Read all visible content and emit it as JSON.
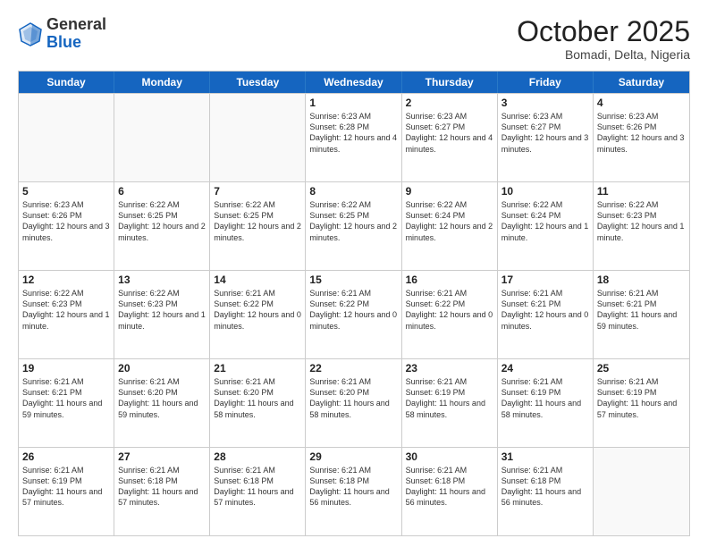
{
  "header": {
    "logo_general": "General",
    "logo_blue": "Blue",
    "month_title": "October 2025",
    "location": "Bomadi, Delta, Nigeria"
  },
  "days_of_week": [
    "Sunday",
    "Monday",
    "Tuesday",
    "Wednesday",
    "Thursday",
    "Friday",
    "Saturday"
  ],
  "weeks": [
    [
      {
        "day": "",
        "empty": true
      },
      {
        "day": "",
        "empty": true
      },
      {
        "day": "",
        "empty": true
      },
      {
        "day": "1",
        "sunrise": "Sunrise: 6:23 AM",
        "sunset": "Sunset: 6:28 PM",
        "daylight": "Daylight: 12 hours and 4 minutes."
      },
      {
        "day": "2",
        "sunrise": "Sunrise: 6:23 AM",
        "sunset": "Sunset: 6:27 PM",
        "daylight": "Daylight: 12 hours and 4 minutes."
      },
      {
        "day": "3",
        "sunrise": "Sunrise: 6:23 AM",
        "sunset": "Sunset: 6:27 PM",
        "daylight": "Daylight: 12 hours and 3 minutes."
      },
      {
        "day": "4",
        "sunrise": "Sunrise: 6:23 AM",
        "sunset": "Sunset: 6:26 PM",
        "daylight": "Daylight: 12 hours and 3 minutes."
      }
    ],
    [
      {
        "day": "5",
        "sunrise": "Sunrise: 6:23 AM",
        "sunset": "Sunset: 6:26 PM",
        "daylight": "Daylight: 12 hours and 3 minutes."
      },
      {
        "day": "6",
        "sunrise": "Sunrise: 6:22 AM",
        "sunset": "Sunset: 6:25 PM",
        "daylight": "Daylight: 12 hours and 2 minutes."
      },
      {
        "day": "7",
        "sunrise": "Sunrise: 6:22 AM",
        "sunset": "Sunset: 6:25 PM",
        "daylight": "Daylight: 12 hours and 2 minutes."
      },
      {
        "day": "8",
        "sunrise": "Sunrise: 6:22 AM",
        "sunset": "Sunset: 6:25 PM",
        "daylight": "Daylight: 12 hours and 2 minutes."
      },
      {
        "day": "9",
        "sunrise": "Sunrise: 6:22 AM",
        "sunset": "Sunset: 6:24 PM",
        "daylight": "Daylight: 12 hours and 2 minutes."
      },
      {
        "day": "10",
        "sunrise": "Sunrise: 6:22 AM",
        "sunset": "Sunset: 6:24 PM",
        "daylight": "Daylight: 12 hours and 1 minute."
      },
      {
        "day": "11",
        "sunrise": "Sunrise: 6:22 AM",
        "sunset": "Sunset: 6:23 PM",
        "daylight": "Daylight: 12 hours and 1 minute."
      }
    ],
    [
      {
        "day": "12",
        "sunrise": "Sunrise: 6:22 AM",
        "sunset": "Sunset: 6:23 PM",
        "daylight": "Daylight: 12 hours and 1 minute."
      },
      {
        "day": "13",
        "sunrise": "Sunrise: 6:22 AM",
        "sunset": "Sunset: 6:23 PM",
        "daylight": "Daylight: 12 hours and 1 minute."
      },
      {
        "day": "14",
        "sunrise": "Sunrise: 6:21 AM",
        "sunset": "Sunset: 6:22 PM",
        "daylight": "Daylight: 12 hours and 0 minutes."
      },
      {
        "day": "15",
        "sunrise": "Sunrise: 6:21 AM",
        "sunset": "Sunset: 6:22 PM",
        "daylight": "Daylight: 12 hours and 0 minutes."
      },
      {
        "day": "16",
        "sunrise": "Sunrise: 6:21 AM",
        "sunset": "Sunset: 6:22 PM",
        "daylight": "Daylight: 12 hours and 0 minutes."
      },
      {
        "day": "17",
        "sunrise": "Sunrise: 6:21 AM",
        "sunset": "Sunset: 6:21 PM",
        "daylight": "Daylight: 12 hours and 0 minutes."
      },
      {
        "day": "18",
        "sunrise": "Sunrise: 6:21 AM",
        "sunset": "Sunset: 6:21 PM",
        "daylight": "Daylight: 11 hours and 59 minutes."
      }
    ],
    [
      {
        "day": "19",
        "sunrise": "Sunrise: 6:21 AM",
        "sunset": "Sunset: 6:21 PM",
        "daylight": "Daylight: 11 hours and 59 minutes."
      },
      {
        "day": "20",
        "sunrise": "Sunrise: 6:21 AM",
        "sunset": "Sunset: 6:20 PM",
        "daylight": "Daylight: 11 hours and 59 minutes."
      },
      {
        "day": "21",
        "sunrise": "Sunrise: 6:21 AM",
        "sunset": "Sunset: 6:20 PM",
        "daylight": "Daylight: 11 hours and 58 minutes."
      },
      {
        "day": "22",
        "sunrise": "Sunrise: 6:21 AM",
        "sunset": "Sunset: 6:20 PM",
        "daylight": "Daylight: 11 hours and 58 minutes."
      },
      {
        "day": "23",
        "sunrise": "Sunrise: 6:21 AM",
        "sunset": "Sunset: 6:19 PM",
        "daylight": "Daylight: 11 hours and 58 minutes."
      },
      {
        "day": "24",
        "sunrise": "Sunrise: 6:21 AM",
        "sunset": "Sunset: 6:19 PM",
        "daylight": "Daylight: 11 hours and 58 minutes."
      },
      {
        "day": "25",
        "sunrise": "Sunrise: 6:21 AM",
        "sunset": "Sunset: 6:19 PM",
        "daylight": "Daylight: 11 hours and 57 minutes."
      }
    ],
    [
      {
        "day": "26",
        "sunrise": "Sunrise: 6:21 AM",
        "sunset": "Sunset: 6:19 PM",
        "daylight": "Daylight: 11 hours and 57 minutes."
      },
      {
        "day": "27",
        "sunrise": "Sunrise: 6:21 AM",
        "sunset": "Sunset: 6:18 PM",
        "daylight": "Daylight: 11 hours and 57 minutes."
      },
      {
        "day": "28",
        "sunrise": "Sunrise: 6:21 AM",
        "sunset": "Sunset: 6:18 PM",
        "daylight": "Daylight: 11 hours and 57 minutes."
      },
      {
        "day": "29",
        "sunrise": "Sunrise: 6:21 AM",
        "sunset": "Sunset: 6:18 PM",
        "daylight": "Daylight: 11 hours and 56 minutes."
      },
      {
        "day": "30",
        "sunrise": "Sunrise: 6:21 AM",
        "sunset": "Sunset: 6:18 PM",
        "daylight": "Daylight: 11 hours and 56 minutes."
      },
      {
        "day": "31",
        "sunrise": "Sunrise: 6:21 AM",
        "sunset": "Sunset: 6:18 PM",
        "daylight": "Daylight: 11 hours and 56 minutes."
      },
      {
        "day": "",
        "empty": true
      }
    ]
  ]
}
